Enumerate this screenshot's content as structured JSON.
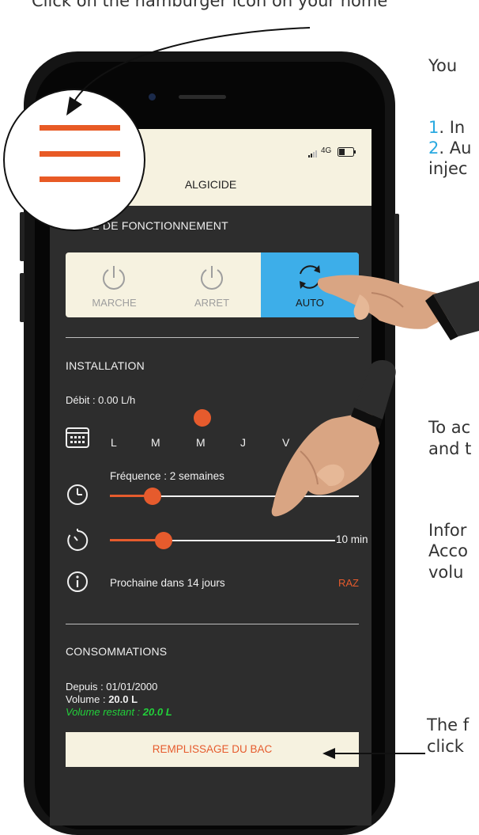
{
  "annotations": {
    "top_text": "Click on the hamburger icon on your home",
    "mode_intro": "You",
    "mode_step1": "In",
    "mode_step2": "Au",
    "mode_step2_cont": "injec",
    "install_a": "To ac",
    "install_b": "and t",
    "info_a": "Infor",
    "info_b": "Acco",
    "info_c": "volu",
    "fill_a": "The f",
    "fill_b": "click"
  },
  "step_numbers": {
    "one": "1",
    "two": "2"
  },
  "status_bar": {
    "network": "4G"
  },
  "header": {
    "title": "ALGICIDE"
  },
  "mode": {
    "section_title": "MODE DE FONCTIONNEMENT",
    "buttons": [
      {
        "label": "MARCHE",
        "state": "inactive"
      },
      {
        "label": "ARRET",
        "state": "inactive"
      },
      {
        "label": "AUTO",
        "state": "active"
      }
    ]
  },
  "installation": {
    "section_title": "INSTALLATION",
    "debit": "Débit : 0.00 L/h",
    "days": [
      "L",
      "M",
      "M",
      "J",
      "V"
    ],
    "selected_day_index": 2,
    "frequency_label": "Fréquence : 2 semaines",
    "frequency_level": 0.17,
    "duration_value": "10 min",
    "duration_level": 0.24,
    "next_label": "Prochaine dans 14 jours",
    "reset_label": "RAZ"
  },
  "consumption": {
    "section_title": "CONSOMMATIONS",
    "since": "Depuis : 01/01/2000",
    "volume_label": "Volume : ",
    "volume_value": "20.0 L",
    "remaining_label": "Volume restant : ",
    "remaining_value": "20.0 L",
    "fill_button": "REMPLISSAGE DU BAC"
  },
  "colors": {
    "accent_orange": "#e65b2d",
    "auto_blue": "#3daee9",
    "screen_bg": "#2d2d2d",
    "panel_cream": "#f6f2e0",
    "remaining_green": "#22d13a"
  },
  "icons": [
    "hamburger-icon",
    "power-icon",
    "refresh-icon",
    "calendar-icon",
    "clock-icon",
    "timer-icon",
    "info-icon",
    "pointing-hand",
    "arrow-left-icon"
  ]
}
